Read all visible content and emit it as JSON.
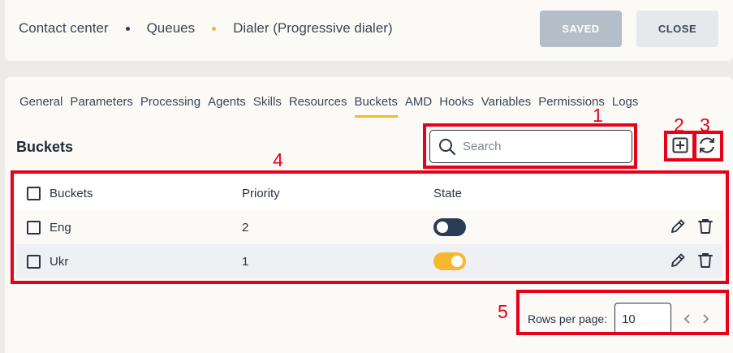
{
  "breadcrumb": {
    "items": [
      "Contact center",
      "Queues",
      "Dialer (Progressive dialer)"
    ],
    "dot_colors": [
      "#2b3d55",
      "#f5b82e"
    ]
  },
  "header": {
    "saved_label": "SAVED",
    "close_label": "CLOSE"
  },
  "tabs": [
    "General",
    "Parameters",
    "Processing",
    "Agents",
    "Skills",
    "Resources",
    "Buckets",
    "AMD",
    "Hooks",
    "Variables",
    "Permissions",
    "Logs"
  ],
  "active_tab": "Buckets",
  "section": {
    "title": "Buckets"
  },
  "search": {
    "placeholder": "Search",
    "value": ""
  },
  "toolbar": {
    "add_icon": "add-square-icon",
    "refresh_icon": "refresh-icon"
  },
  "table": {
    "columns": [
      "Buckets",
      "Priority",
      "State"
    ],
    "rows": [
      {
        "name": "Eng",
        "priority": "2",
        "state": false
      },
      {
        "name": "Ukr",
        "priority": "1",
        "state": true
      }
    ]
  },
  "pagination": {
    "rows_per_page_label": "Rows per page:",
    "rows_per_page_value": "10"
  },
  "annotations": [
    "1",
    "2",
    "3",
    "4",
    "5"
  ],
  "colors": {
    "accent": "#f5b82e",
    "dark": "#2b3d55",
    "annotation": "#e8001b",
    "saved_bg": "#b3bec8"
  }
}
